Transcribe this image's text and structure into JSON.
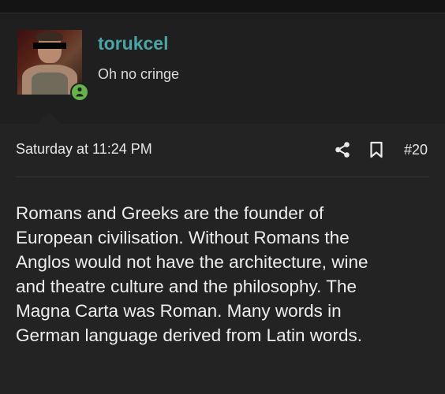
{
  "user": {
    "username": "torukcel",
    "title": "Oh no cringe",
    "status": "online"
  },
  "post": {
    "timestamp": "Saturday at 11:24 PM",
    "number": "#20",
    "lines": [
      "Romans and Greeks are the founder of",
      "European civilisation. Without Romans the",
      "Anglos would not have the architecture, wine",
      "and theatre culture and the philosophy. The",
      "Magna Carta was Roman. Many words in",
      "German language derived from Latin words."
    ]
  },
  "icons": {
    "share": "share-icon",
    "bookmark": "bookmark-icon",
    "online": "user-online-icon"
  },
  "colors": {
    "username": "#4aa5a5",
    "online": "#63b449",
    "background": "#1e1e1e"
  }
}
